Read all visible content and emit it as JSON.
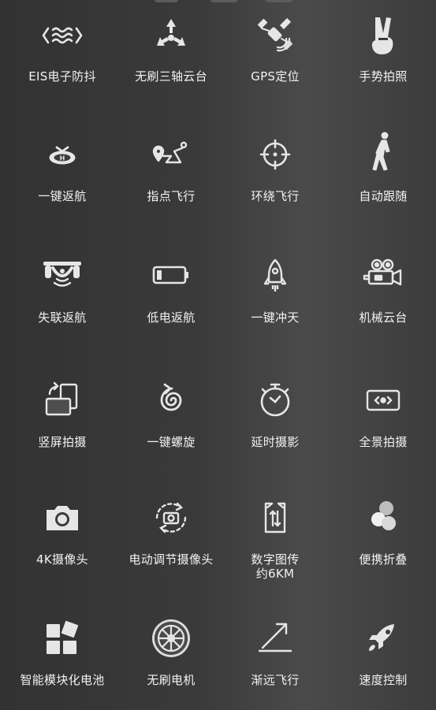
{
  "features": [
    {
      "label": "EIS电子防抖",
      "icon": "wave-stabilizer-icon"
    },
    {
      "label": "无刷三轴云台",
      "icon": "triad-gimbal-icon"
    },
    {
      "label": "GPS定位",
      "icon": "satellite-icon"
    },
    {
      "label": "手势拍照",
      "icon": "peace-hand-icon"
    },
    {
      "label": "一键返航",
      "icon": "helipad-icon"
    },
    {
      "label": "指点飞行",
      "icon": "waypoint-icon"
    },
    {
      "label": "环绕飞行",
      "icon": "crosshair-icon"
    },
    {
      "label": "自动跟随",
      "icon": "walking-person-icon"
    },
    {
      "label": "失联返航",
      "icon": "drone-signal-icon"
    },
    {
      "label": "低电返航",
      "icon": "low-battery-icon"
    },
    {
      "label": "一键冲天",
      "icon": "rocket-icon"
    },
    {
      "label": "机械云台",
      "icon": "movie-camera-icon"
    },
    {
      "label": "竖屏拍摄",
      "icon": "rotate-screen-icon"
    },
    {
      "label": "一键螺旋",
      "icon": "spiral-icon"
    },
    {
      "label": "延时摄影",
      "icon": "stopwatch-icon"
    },
    {
      "label": "全景拍摄",
      "icon": "panorama-icon"
    },
    {
      "label": "4K摄像头",
      "icon": "camera-icon"
    },
    {
      "label": "电动调节摄像头",
      "icon": "camera-rotate-icon"
    },
    {
      "label": "数字图传\n约6KM",
      "icon": "signal-transfer-icon"
    },
    {
      "label": "便携折叠",
      "icon": "fold-circles-icon"
    },
    {
      "label": "智能模块化电池",
      "icon": "module-blocks-icon"
    },
    {
      "label": "无刷电机",
      "icon": "motor-wheel-icon"
    },
    {
      "label": "渐远飞行",
      "icon": "angle-arrow-icon"
    },
    {
      "label": "速度控制",
      "icon": "speed-rocket-icon"
    }
  ]
}
